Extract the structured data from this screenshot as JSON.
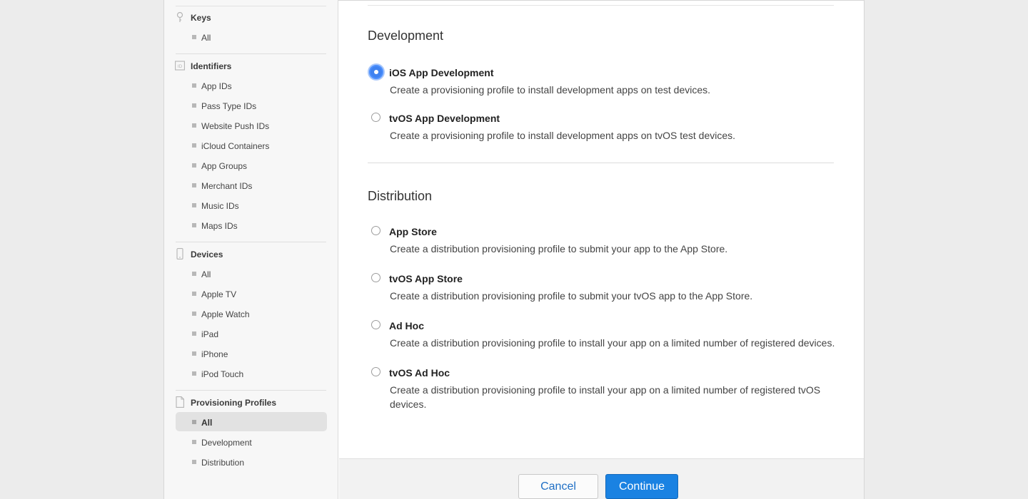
{
  "sidebar": {
    "keys": {
      "title": "Keys",
      "items": [
        "All"
      ]
    },
    "identifiers": {
      "title": "Identifiers",
      "icon_text": "ID",
      "items": [
        "App IDs",
        "Pass Type IDs",
        "Website Push IDs",
        "iCloud Containers",
        "App Groups",
        "Merchant IDs",
        "Music IDs",
        "Maps IDs"
      ]
    },
    "devices": {
      "title": "Devices",
      "items": [
        "All",
        "Apple TV",
        "Apple Watch",
        "iPad",
        "iPhone",
        "iPod Touch"
      ]
    },
    "profiles": {
      "title": "Provisioning Profiles",
      "items": [
        "All",
        "Development",
        "Distribution"
      ],
      "active": "All"
    }
  },
  "main": {
    "development": {
      "heading": "Development",
      "options": [
        {
          "title": "iOS App Development",
          "desc": "Create a provisioning profile to install development apps on test devices.",
          "selected": true
        },
        {
          "title": "tvOS App Development",
          "desc": "Create a provisioning profile to install development apps on tvOS test devices.",
          "selected": false
        }
      ]
    },
    "distribution": {
      "heading": "Distribution",
      "options": [
        {
          "title": "App Store",
          "desc": "Create a distribution provisioning profile to submit your app to the App Store.",
          "selected": false
        },
        {
          "title": "tvOS App Store",
          "desc": "Create a distribution provisioning profile to submit your tvOS app to the App Store.",
          "selected": false
        },
        {
          "title": "Ad Hoc",
          "desc": "Create a distribution provisioning profile to install your app on a limited number of registered devices.",
          "selected": false
        },
        {
          "title": "tvOS Ad Hoc",
          "desc": "Create a distribution provisioning profile to install your app on a limited number of registered tvOS devices.",
          "selected": false
        }
      ]
    }
  },
  "footer": {
    "cancel_label": "Cancel",
    "continue_label": "Continue"
  },
  "colors": {
    "accent": "#1a82e2",
    "radio_selected": "#3f82f0",
    "sidebar_bg": "#f7f7f7",
    "footer_bg": "#f2f2f2"
  }
}
